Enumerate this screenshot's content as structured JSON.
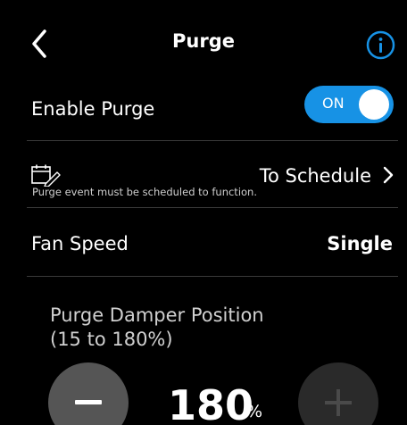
{
  "header": {
    "title": "Purge",
    "back_icon": "chevron-left-icon",
    "info_icon": "info-icon"
  },
  "enable_purge": {
    "label": "Enable Purge",
    "toggle_text": "ON",
    "toggle_state": true,
    "accent_color": "#1792e5"
  },
  "schedule": {
    "icon": "calendar-edit-icon",
    "link_text": "To Schedule",
    "chevron_icon": "chevron-right-icon",
    "note": "Purge event must be scheduled to function."
  },
  "fan_speed": {
    "label": "Fan Speed",
    "value": "Single"
  },
  "damper": {
    "title_line1": "Purge Damper Position",
    "title_line2": "(15 to 180%)",
    "value": "180",
    "unit": "%",
    "minus_icon": "minus-icon",
    "plus_icon": "plus-icon"
  }
}
